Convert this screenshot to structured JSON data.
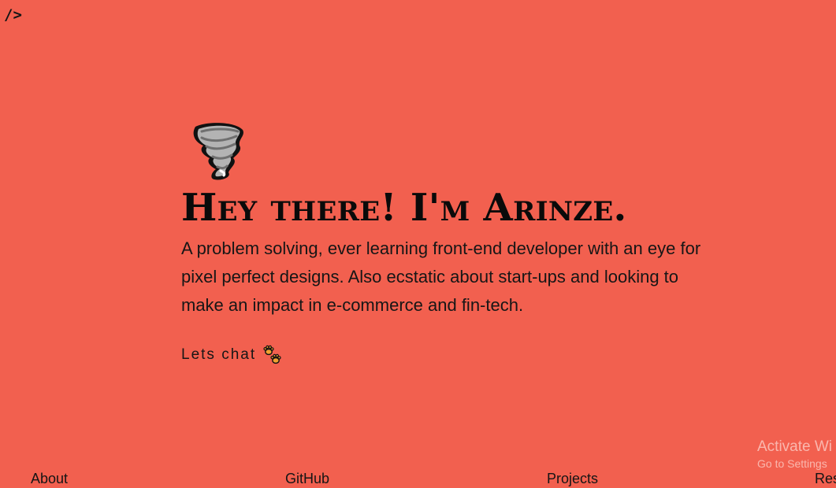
{
  "logo": {
    "text": "/>"
  },
  "hero": {
    "emoji_icon": "tornado-icon",
    "title": "Hey there! I'm Arinze.",
    "bio": "A problem solving, ever learning front-end developer with an eye for pixel perfect designs. Also ecstatic about start-ups and looking to make an impact in e-commerce and fin-tech.",
    "cta_label": "Lets chat",
    "cta_icon": "paw-prints-icon"
  },
  "watermark": {
    "title": "Activate Wi",
    "subtitle": "Go to Settings"
  },
  "nav": {
    "items": [
      {
        "label": "About"
      },
      {
        "label": "GitHub"
      },
      {
        "label": "Projects"
      },
      {
        "label": "Res"
      }
    ]
  },
  "colors": {
    "background": "#f2604f",
    "text": "#111111"
  }
}
